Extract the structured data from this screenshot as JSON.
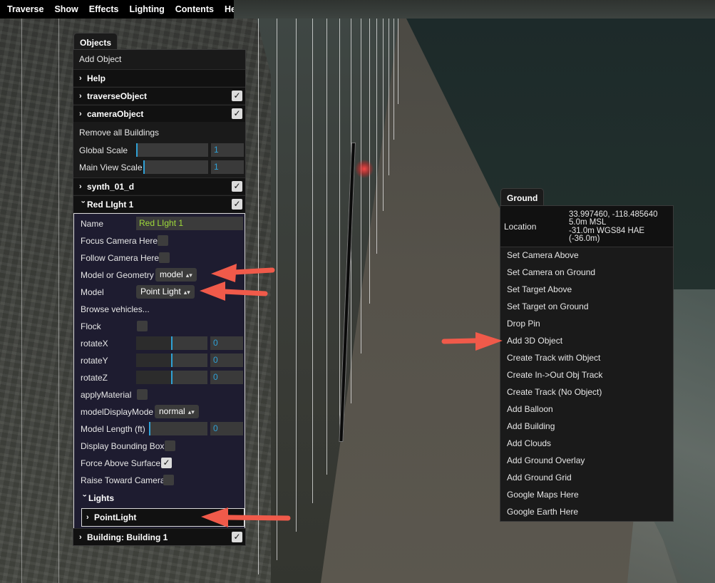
{
  "menubar": {
    "items": [
      "Traverse",
      "Show",
      "Effects",
      "Lighting",
      "Contents",
      "Help"
    ]
  },
  "objects_panel": {
    "tab_label": "Objects",
    "add_object": "Add Object",
    "help": "Help",
    "traverse_object": "traverseObject",
    "camera_object": "cameraObject",
    "remove_buildings": "Remove all Buildings",
    "global_scale": {
      "label": "Global Scale",
      "value": "1",
      "fraction": 0.0
    },
    "main_view_scale": {
      "label": "Main View Scale",
      "value": "1",
      "fraction": 0.08
    },
    "synth": "synth_01_d",
    "red_light_folder": "Red LIght 1",
    "red_light": {
      "name_label": "Name",
      "name_value": "Red LIght 1",
      "focus_camera": "Focus Camera Here",
      "follow_camera": "Follow Camera Here",
      "model_or_geometry_label": "Model or Geometry",
      "model_or_geometry_value": "model",
      "model_label": "Model",
      "model_value": "Point Light",
      "browse_vehicles": "Browse vehicles...",
      "flock": "Flock",
      "rotate_x": {
        "label": "rotateX",
        "value": "0",
        "fraction": 0.5
      },
      "rotate_y": {
        "label": "rotateY",
        "value": "0",
        "fraction": 0.5
      },
      "rotate_z": {
        "label": "rotateZ",
        "value": "0",
        "fraction": 0.5
      },
      "apply_material": "applyMaterial",
      "model_display_mode_label": "modelDisplayMode",
      "model_display_mode_value": "normal",
      "model_length": {
        "label": "Model Length (ft)",
        "value": "0",
        "fraction": 0.0
      },
      "display_bounding_box": "Display Bounding Box",
      "force_above_surface": "Force Above Surface",
      "raise_toward_camera": "Raise Toward Camera",
      "lights": "Lights",
      "point_light": "PointLight"
    },
    "building": "Building: Building 1"
  },
  "ground_panel": {
    "tab_label": "Ground",
    "location_label": "Location",
    "location_lines": [
      "33.997460, -118.485640",
      "5.0m MSL",
      "-31.0m WGS84 HAE",
      "(-36.0m)"
    ],
    "items": [
      "Set Camera Above",
      "Set Camera on Ground",
      "Set Target Above",
      "Set Target on Ground",
      "Drop Pin",
      "Add 3D Object",
      "Create Track with Object",
      "Create In->Out Obj Track",
      "Create Track (No Object)",
      "Add Balloon",
      "Add Building",
      "Add Clouds",
      "Add Ground Overlay",
      "Add Ground Grid",
      "Google Maps Here",
      "Google Earth Here"
    ]
  },
  "colors": {
    "accent_blue": "#2fa1d6",
    "name_green": "#9fdb3a",
    "arrow_red": "#f05a4a",
    "light_red": "#ff4646"
  },
  "icons": {
    "chevron": "chevron-right-icon",
    "check": "checkmark-icon",
    "select_arrow": "up-down-arrows-icon"
  }
}
